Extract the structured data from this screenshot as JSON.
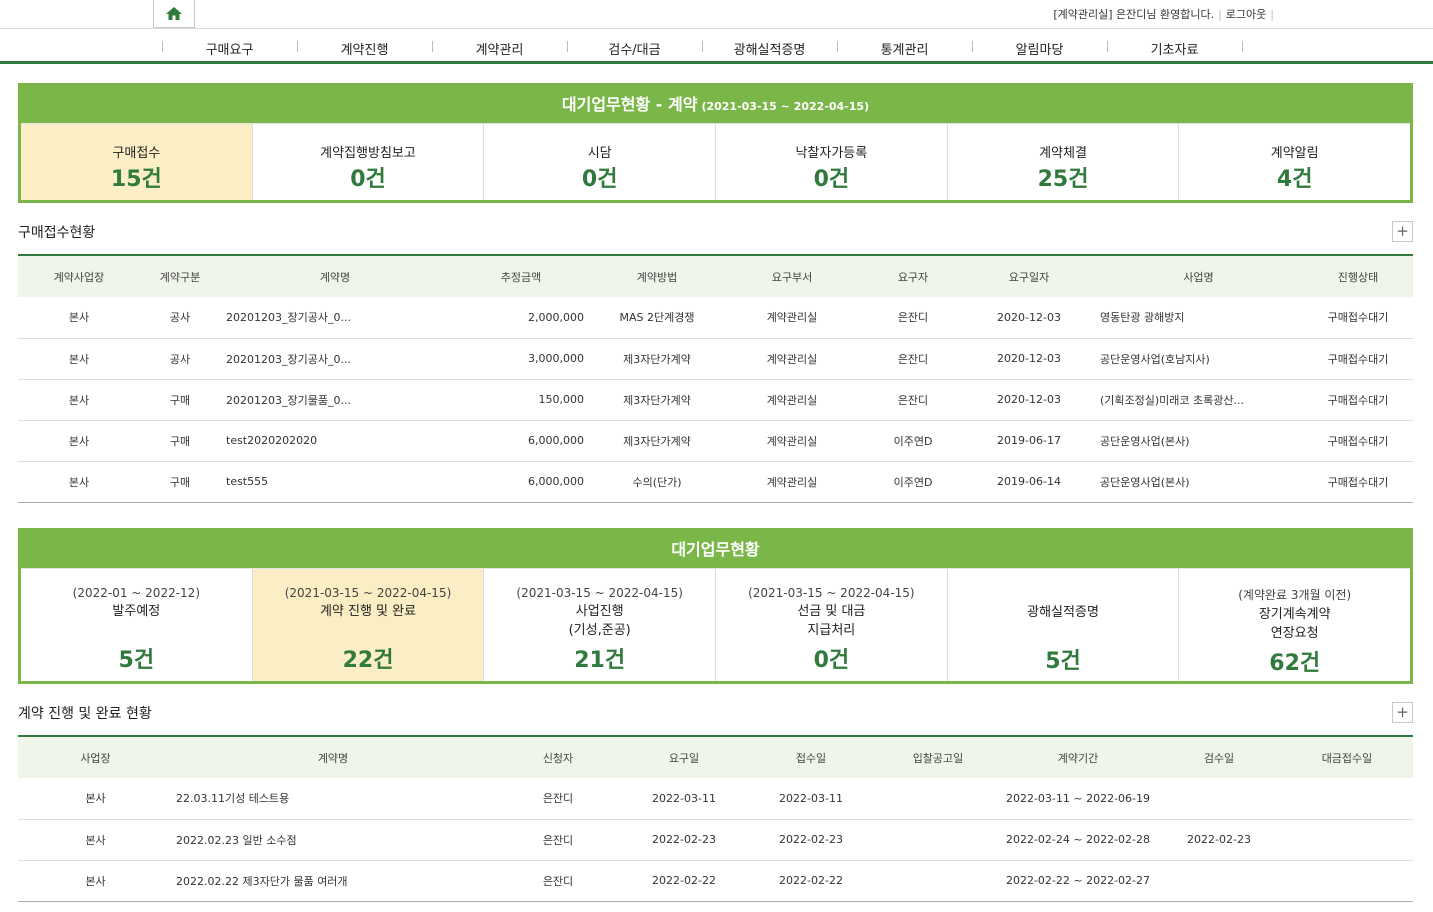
{
  "header": {
    "user_dept": "[계약관리실]",
    "user_greeting": "은잔디님 환영합니다.",
    "logout_label": "로그아웃"
  },
  "nav": [
    "구매요구",
    "계약진행",
    "계약관리",
    "검수/대금",
    "광해실적증명",
    "통계관리",
    "알림마당",
    "기초자료"
  ],
  "panel1": {
    "title": "대기업무현황 - 계약",
    "range": "(2021-03-15 ~ 2022-04-15)",
    "cells": [
      {
        "label": "구매접수",
        "count": "15건"
      },
      {
        "label": "계약집행방침보고",
        "count": "0건"
      },
      {
        "label": "시담",
        "count": "0건"
      },
      {
        "label": "낙찰자가등록",
        "count": "0건"
      },
      {
        "label": "계약체결",
        "count": "25건"
      },
      {
        "label": "계약알림",
        "count": "4건"
      }
    ]
  },
  "section1": {
    "title": "구매접수현황",
    "columns": [
      "계약사업장",
      "계약구분",
      "계약명",
      "추정금액",
      "계약방법",
      "요구부서",
      "요구자",
      "요구일자",
      "사업명",
      "진행상태"
    ],
    "rows": [
      [
        "본사",
        "공사",
        "20201203_장기공사_0...",
        "2,000,000",
        "MAS 2단계경쟁",
        "계약관리실",
        "은잔디",
        "2020-12-03",
        "영동탄광 광해방지",
        "구매접수대기"
      ],
      [
        "본사",
        "공사",
        "20201203_장기공사_0...",
        "3,000,000",
        "제3자단가계약",
        "계약관리실",
        "은잔디",
        "2020-12-03",
        "공단운영사업(호남지사)",
        "구매접수대기"
      ],
      [
        "본사",
        "구매",
        "20201203_장기물품_0...",
        "150,000",
        "제3자단가계약",
        "계약관리실",
        "은잔디",
        "2020-12-03",
        "(기획조정실)미래코 초록광산...",
        "구매접수대기"
      ],
      [
        "본사",
        "구매",
        "test2020202020",
        "6,000,000",
        "제3자단가계약",
        "계약관리실",
        "이주연D",
        "2019-06-17",
        "공단운영사업(본사)",
        "구매접수대기"
      ],
      [
        "본사",
        "구매",
        "test555",
        "6,000,000",
        "수의(단가)",
        "계약관리실",
        "이주연D",
        "2019-06-14",
        "공단운영사업(본사)",
        "구매접수대기"
      ]
    ]
  },
  "panel2": {
    "title": "대기업무현황",
    "cells": [
      {
        "sub": "(2022-01 ~ 2022-12)",
        "label1": "발주예정",
        "label2": "",
        "count": "5건"
      },
      {
        "sub": "(2021-03-15 ~ 2022-04-15)",
        "label1": "계약 진행 및 완료",
        "label2": "",
        "count": "22건"
      },
      {
        "sub": "(2021-03-15 ~ 2022-04-15)",
        "label1": "사업진행",
        "label2": "(기성,준공)",
        "count": "21건"
      },
      {
        "sub": "(2021-03-15 ~ 2022-04-15)",
        "label1": "선금 및 대금",
        "label2": "지급처리",
        "count": "0건"
      },
      {
        "sub": "",
        "label1": "광해실적증명",
        "label2": "",
        "count": "5건"
      },
      {
        "sub": "(계약완료 3개월 이전)",
        "label1": "장기계속계약",
        "label2": "연장요청",
        "count": "62건"
      }
    ]
  },
  "section2": {
    "title": "계약 진행 및 완료 현황",
    "columns": [
      "사업장",
      "계약명",
      "신청자",
      "요구일",
      "접수일",
      "입찰공고일",
      "계약기간",
      "검수일",
      "대금접수일"
    ],
    "rows": [
      [
        "본사",
        "22.03.11기성 테스트용",
        "은잔디",
        "2022-03-11",
        "2022-03-11",
        "",
        "2022-03-11 ~ 2022-06-19",
        "",
        ""
      ],
      [
        "본사",
        "2022.02.23 일반 소수점",
        "은잔디",
        "2022-02-23",
        "2022-02-23",
        "",
        "2022-02-24 ~ 2022-02-28",
        "2022-02-23",
        ""
      ],
      [
        "본사",
        "2022.02.22 제3자단가 물품 여러개",
        "은잔디",
        "2022-02-22",
        "2022-02-22",
        "",
        "2022-02-22 ~ 2022-02-27",
        "",
        ""
      ]
    ]
  },
  "colors": {
    "accent_green": "#7ab648",
    "dark_green": "#2f7a3c",
    "highlight": "#fbedc4"
  },
  "icons": {
    "home": "home-icon",
    "expand": "plus-icon"
  }
}
